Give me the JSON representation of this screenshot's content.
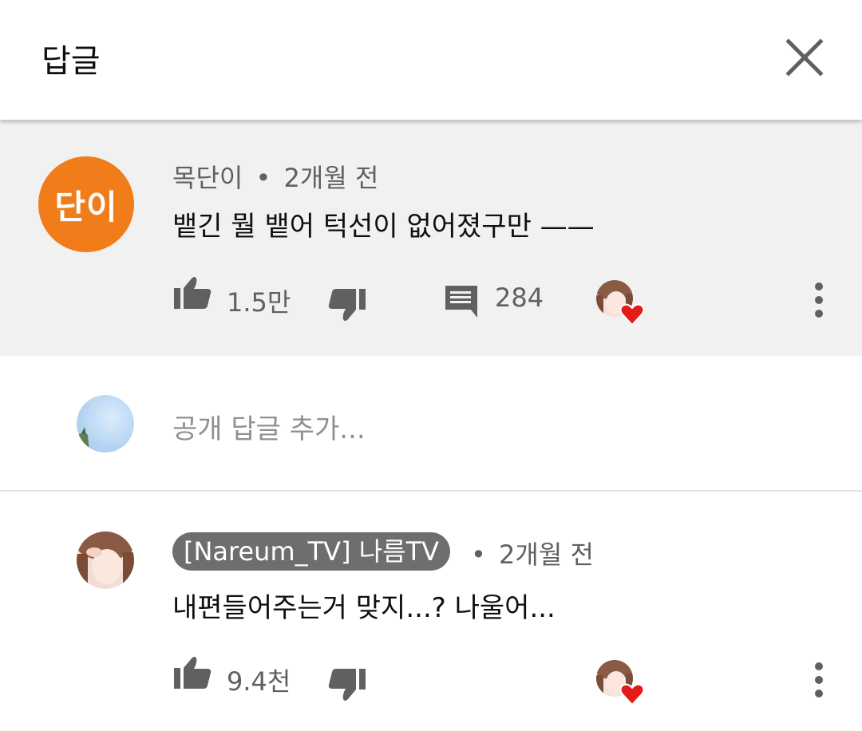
{
  "header": {
    "title": "답글",
    "close_icon": "close-icon"
  },
  "top_comment": {
    "avatar_text": "단이",
    "avatar_color": "#f07d1a",
    "author": "목단이",
    "separator": "•",
    "time": "2개월 전",
    "text": "뱉긴 뭘 뱉어 턱선이 없어졌구만 ——",
    "likes": "1.5만",
    "replies": "284"
  },
  "reply_input": {
    "placeholder": "공개 답글 추가..."
  },
  "reply": {
    "author": "[Nareum_TV] 나름TV",
    "separator": "•",
    "time": "2개월 전",
    "text": "내편들어주는거 맞지...? 나울어...",
    "likes": "9.4천"
  },
  "colors": {
    "heart": "#e41b17",
    "badge_bg": "#6e6e6e",
    "top_bg": "#f1f1f1"
  }
}
